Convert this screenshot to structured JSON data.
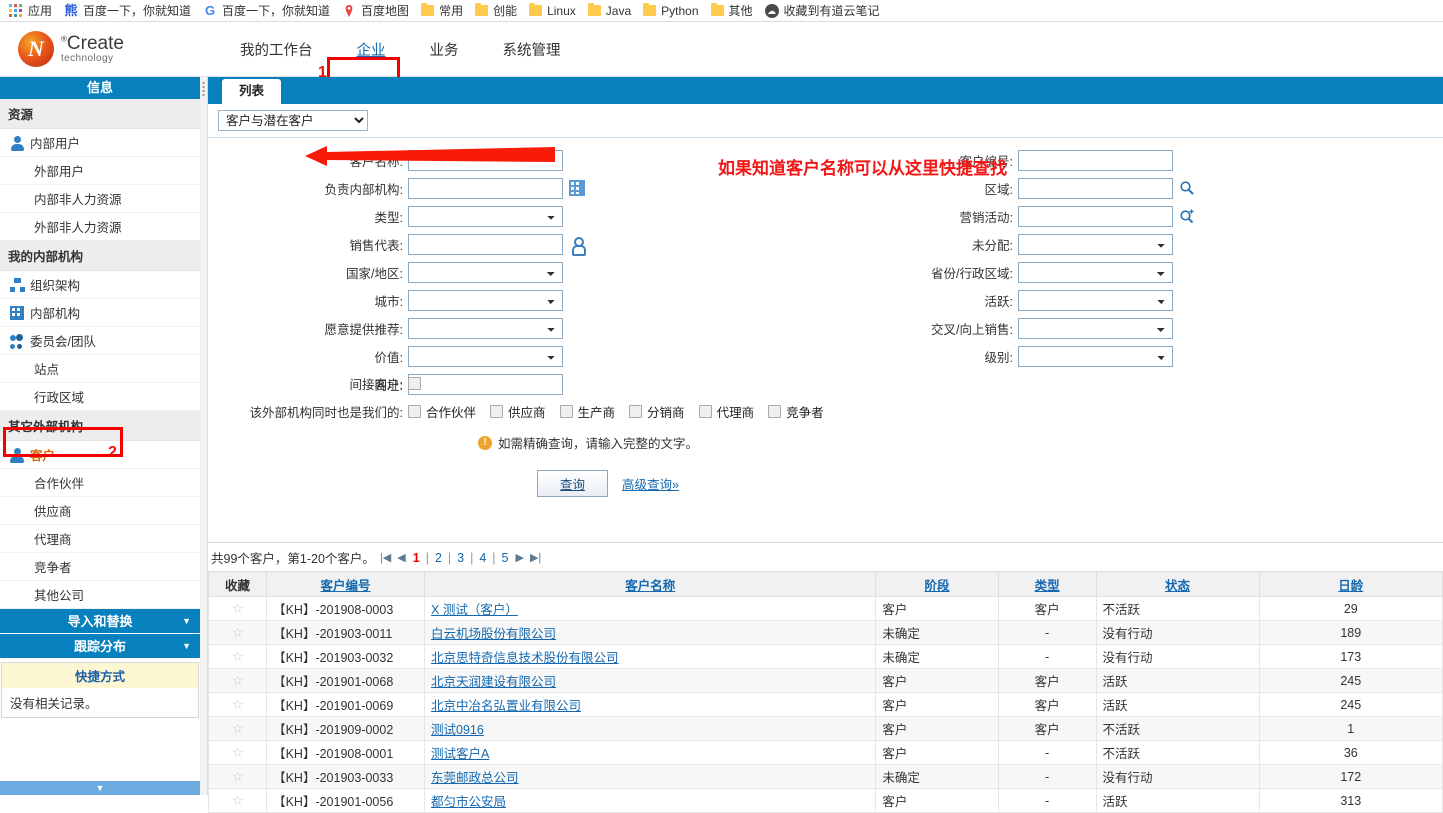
{
  "browser": {
    "bookmarks": [
      {
        "icon": "apps-grid-icon",
        "label": "应用"
      },
      {
        "icon": "baidu-icon",
        "label": "百度一下，你就知道"
      },
      {
        "icon": "google-icon",
        "label": "百度一下，你就知道"
      },
      {
        "icon": "baidu-map-pin-icon",
        "label": "百度地图"
      },
      {
        "icon": "folder-icon",
        "label": "常用"
      },
      {
        "icon": "folder-icon",
        "label": "创能"
      },
      {
        "icon": "folder-icon",
        "label": "Linux"
      },
      {
        "icon": "folder-icon",
        "label": "Java"
      },
      {
        "icon": "folder-icon",
        "label": "Python"
      },
      {
        "icon": "folder-icon",
        "label": "其他"
      },
      {
        "icon": "youdao-note-icon",
        "label": "收藏到有道云笔记"
      }
    ]
  },
  "brand": {
    "name": "Create",
    "reg": "®",
    "tagline": "technology"
  },
  "topnav": {
    "items": [
      {
        "label": "我的工作台",
        "active": false
      },
      {
        "label": "企业",
        "active": true
      },
      {
        "label": "业务",
        "active": false
      },
      {
        "label": "系统管理",
        "active": false
      }
    ],
    "step1_badge": "1"
  },
  "sidebar": {
    "header": "信息",
    "groups": [
      {
        "title": "资源",
        "items": [
          {
            "label": "内部用户",
            "icon": "person-icon",
            "selected": false
          },
          {
            "label": "外部用户",
            "icon": null,
            "selected": false
          },
          {
            "label": "内部非人力资源",
            "icon": null,
            "selected": false
          },
          {
            "label": "外部非人力资源",
            "icon": null,
            "selected": false
          }
        ]
      },
      {
        "title": "我的内部机构",
        "items": [
          {
            "label": "组织架构",
            "icon": "org-chart-icon",
            "selected": false
          },
          {
            "label": "内部机构",
            "icon": "building-icon",
            "selected": false
          },
          {
            "label": "委员会/团队",
            "icon": "team-icon",
            "selected": false
          },
          {
            "label": "站点",
            "icon": null,
            "selected": false
          },
          {
            "label": "行政区域",
            "icon": null,
            "selected": false
          }
        ]
      },
      {
        "title": "其它外部机构",
        "items": [
          {
            "label": "客户",
            "icon": "customer-icon",
            "selected": true
          },
          {
            "label": "合作伙伴",
            "icon": null,
            "selected": false
          },
          {
            "label": "供应商",
            "icon": null,
            "selected": false
          },
          {
            "label": "代理商",
            "icon": null,
            "selected": false
          },
          {
            "label": "竞争者",
            "icon": null,
            "selected": false
          },
          {
            "label": "其他公司",
            "icon": null,
            "selected": false
          }
        ]
      }
    ],
    "step2_badge": "2",
    "blue_sections": [
      {
        "label": "导入和替换"
      },
      {
        "label": "跟踪分布"
      }
    ],
    "shortcut": {
      "title": "快捷方式",
      "empty": "没有相关记录。"
    }
  },
  "main": {
    "tab": "列表",
    "view_select": {
      "value": "客户与潜在客户",
      "options": [
        "客户与潜在客户"
      ]
    },
    "form": {
      "left": [
        {
          "label": "客户名称:",
          "type": "text",
          "value": "",
          "icon": null
        },
        {
          "label": "负责内部机构:",
          "type": "text",
          "value": "",
          "icon": "building-picker-icon"
        },
        {
          "label": "类型:",
          "type": "select",
          "value": "",
          "icon": null
        },
        {
          "label": "销售代表:",
          "type": "text",
          "value": "",
          "icon": "user-picker-icon"
        },
        {
          "label": "国家/地区:",
          "type": "select",
          "value": "",
          "icon": null
        },
        {
          "label": "城市:",
          "type": "select",
          "value": "",
          "icon": null
        },
        {
          "label": "愿意提供推荐:",
          "type": "select",
          "value": "",
          "icon": null
        },
        {
          "label": "价值:",
          "type": "select",
          "value": "",
          "icon": null
        },
        {
          "label": "网址:",
          "type": "text",
          "value": "",
          "icon": null
        }
      ],
      "right": [
        {
          "label": "客户编号:",
          "type": "text",
          "value": "",
          "icon": null
        },
        {
          "label": "区域:",
          "type": "text",
          "value": "",
          "icon": "search-icon"
        },
        {
          "label": "营销活动:",
          "type": "text",
          "value": "",
          "icon": "search-plus-icon"
        },
        {
          "label": "未分配:",
          "type": "select",
          "value": "",
          "icon": null
        },
        {
          "label": "省份/行政区域:",
          "type": "select",
          "value": "",
          "icon": null
        },
        {
          "label": "活跃:",
          "type": "select",
          "value": "",
          "icon": null
        },
        {
          "label": "交叉/向上销售:",
          "type": "select",
          "value": "",
          "icon": null
        },
        {
          "label": "级别:",
          "type": "select",
          "value": "",
          "icon": null
        }
      ],
      "indirect_label": "间接客户:",
      "also_label": "该外部机构同时也是我们的:",
      "also_options": [
        "合作伙伴",
        "供应商",
        "生产商",
        "分销商",
        "代理商",
        "竞争者"
      ],
      "hint": "如需精确查询，请输入完整的文字。",
      "query_button": "查询",
      "advanced_link": "高级查询»"
    },
    "annotation": {
      "text": "如果知道客户名称可以从这里快捷查找"
    },
    "results": {
      "summary": "共99个客户，第1-20个客户。",
      "pages": [
        "1",
        "2",
        "3",
        "4",
        "5"
      ],
      "current_page": "1",
      "columns": [
        "收藏",
        "客户编号",
        "客户名称",
        "阶段",
        "类型",
        "状态",
        "日龄"
      ],
      "column_sortable": [
        false,
        true,
        true,
        true,
        true,
        true,
        true
      ],
      "rows": [
        {
          "fav": "☆",
          "code": "【KH】-201908-0003",
          "name": "X 测试（客户）",
          "stage": "客户",
          "type": "客户",
          "status": "不活跃",
          "age": "29"
        },
        {
          "fav": "☆",
          "code": "【KH】-201903-0011",
          "name": "白云机场股份有限公司",
          "stage": "未确定",
          "type": "-",
          "status": "没有行动",
          "age": "189"
        },
        {
          "fav": "☆",
          "code": "【KH】-201903-0032",
          "name": "北京思特奇信息技术股份有限公司",
          "stage": "未确定",
          "type": "-",
          "status": "没有行动",
          "age": "173"
        },
        {
          "fav": "☆",
          "code": "【KH】-201901-0068",
          "name": "北京天润建设有限公司",
          "stage": "客户",
          "type": "客户",
          "status": "活跃",
          "age": "245"
        },
        {
          "fav": "☆",
          "code": "【KH】-201901-0069",
          "name": "北京中冶名弘置业有限公司",
          "stage": "客户",
          "type": "客户",
          "status": "活跃",
          "age": "245"
        },
        {
          "fav": "☆",
          "code": "【KH】-201909-0002",
          "name": "测试0916",
          "stage": "客户",
          "type": "客户",
          "status": "不活跃",
          "age": "1"
        },
        {
          "fav": "☆",
          "code": "【KH】-201908-0001",
          "name": "测试客户A",
          "stage": "客户",
          "type": "-",
          "status": "不活跃",
          "age": "36"
        },
        {
          "fav": "☆",
          "code": "【KH】-201903-0033",
          "name": "东莞邮政总公司",
          "stage": "未确定",
          "type": "-",
          "status": "没有行动",
          "age": "172"
        },
        {
          "fav": "☆",
          "code": "【KH】-201901-0056",
          "name": "都匀市公安局",
          "stage": "客户",
          "type": "-",
          "status": "活跃",
          "age": "313"
        }
      ]
    }
  },
  "colors": {
    "header_blue": "#0781bd",
    "link_blue": "#1469b0",
    "annotation_red": "#f31616",
    "selected_orange": "#d9670a",
    "current_page_red": "#ee0000"
  }
}
